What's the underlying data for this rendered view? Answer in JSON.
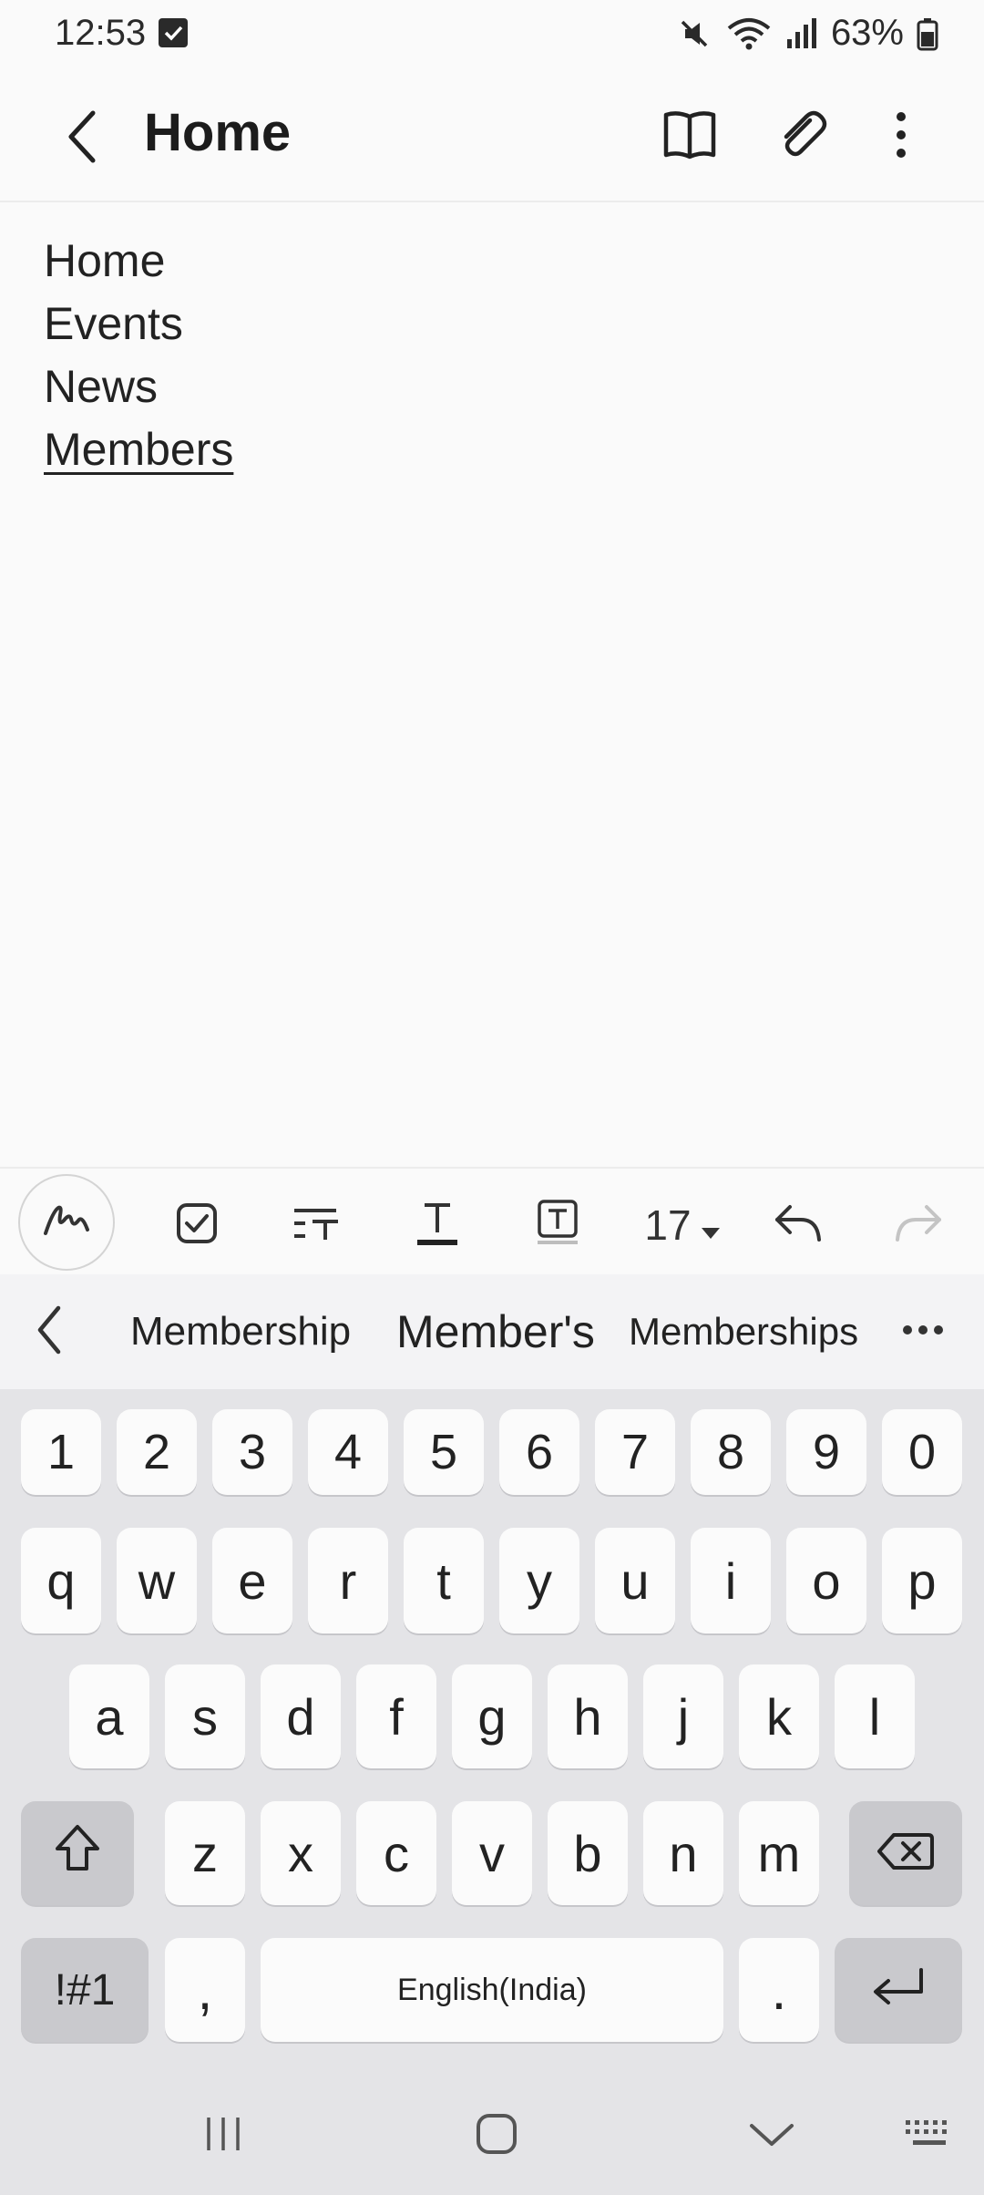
{
  "status": {
    "time": "12:53",
    "battery": "63%",
    "icons": [
      "notification-check-icon",
      "mute-icon",
      "wifi-icon",
      "signal-icon",
      "battery-icon"
    ]
  },
  "app_bar": {
    "title": "Home",
    "icons": [
      "back-icon",
      "reading-mode-icon",
      "attach-icon",
      "more-options-icon"
    ]
  },
  "note": {
    "lines": [
      "Home",
      "Events",
      "News",
      "Members"
    ]
  },
  "format_toolbar": {
    "font_size": "17",
    "icons": [
      "handwriting-pen-icon",
      "checkbox-icon",
      "paragraph-style-icon",
      "text-color-icon",
      "text-background-icon",
      "font-size-dropdown-icon",
      "undo-icon",
      "redo-icon"
    ]
  },
  "suggestions": {
    "items": [
      "Membership",
      "Member's",
      "Memberships"
    ],
    "icons": [
      "collapse-toolbar-icon",
      "more-suggestions-icon"
    ]
  },
  "keyboard": {
    "row_numbers": [
      "1",
      "2",
      "3",
      "4",
      "5",
      "6",
      "7",
      "8",
      "9",
      "0"
    ],
    "row_top": [
      "q",
      "w",
      "e",
      "r",
      "t",
      "y",
      "u",
      "i",
      "o",
      "p"
    ],
    "row_middle": [
      "a",
      "s",
      "d",
      "f",
      "g",
      "h",
      "j",
      "k",
      "l"
    ],
    "row_bottom": [
      "z",
      "x",
      "c",
      "v",
      "b",
      "n",
      "m"
    ],
    "symbols_key": "!#1",
    "comma_key": ",",
    "space_key": "English(India)",
    "period_key": ".",
    "icons": [
      "shift-icon",
      "backspace-icon",
      "enter-icon"
    ]
  },
  "nav_bar": {
    "icons": [
      "recent-apps-icon",
      "home-icon",
      "hide-keyboard-icon",
      "keyboard-switch-icon"
    ]
  },
  "colors": {
    "background": "#fafafa",
    "keyboard_bg": "#e4e4e7",
    "key_bg": "#fbfbfb",
    "dark_key_bg": "#c9c9cd",
    "text": "#1c1c1c"
  }
}
